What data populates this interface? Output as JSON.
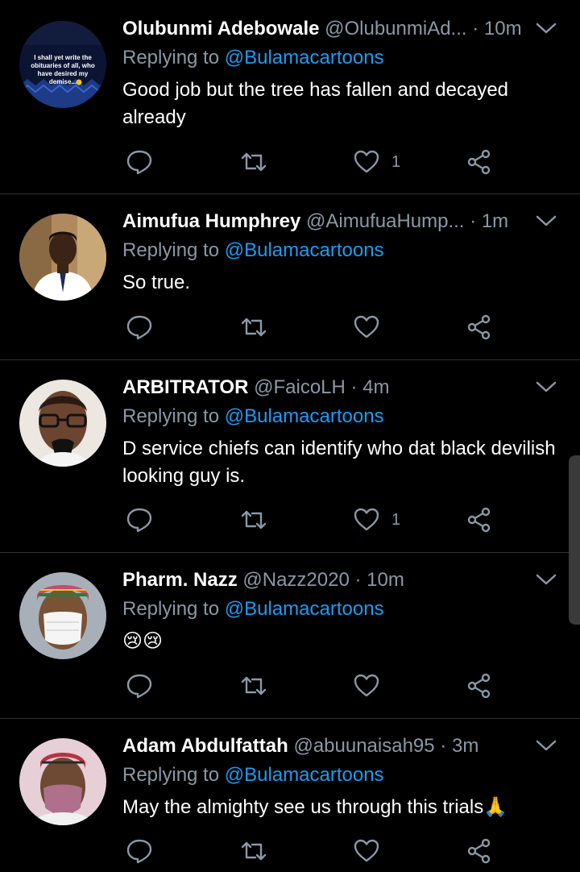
{
  "tweets": [
    {
      "name": "Olubunmi Adebowale",
      "handle": "@OlubunmiAd...",
      "time": "10m",
      "reply_prefix": "Replying to ",
      "reply_to": "@Bulamacartoons",
      "text": "Good job but the tree has fallen and decayed already",
      "likes": "1",
      "avatar_text": "I shall yet write the obituaries of all, who have desired my demise...😊"
    },
    {
      "name": "Aimufua Humphrey",
      "handle": "@AimufuaHump...",
      "time": "1m",
      "reply_prefix": "Replying to ",
      "reply_to": "@Bulamacartoons",
      "text": "So true.",
      "likes": ""
    },
    {
      "name": "ARBITRATOR",
      "handle": "@FaicoLH",
      "time": "4m",
      "reply_prefix": "Replying to ",
      "reply_to": "@Bulamacartoons",
      "text": "D service chiefs can identify who dat black devilish looking guy is.",
      "likes": "1"
    },
    {
      "name": "Pharm. Nazz",
      "handle": "@Nazz2020",
      "time": "10m",
      "reply_prefix": "Replying to ",
      "reply_to": "@Bulamacartoons",
      "text": "😢😢",
      "likes": ""
    },
    {
      "name": "Adam Abdulfattah",
      "handle": "@abuunaisah95",
      "time": "3m",
      "reply_prefix": "Replying to ",
      "reply_to": "@Bulamacartoons",
      "text": "May the almighty see us through this trials🙏",
      "likes": ""
    }
  ],
  "icons": {
    "reply": "comment-icon",
    "retweet": "retweet-icon",
    "like": "heart-icon",
    "share": "share-icon",
    "more": "chevron-down-icon"
  },
  "colors": {
    "background": "#000000",
    "secondary_text": "#8b98a5",
    "mention": "#1d9bf0",
    "divider": "#2f3336"
  }
}
